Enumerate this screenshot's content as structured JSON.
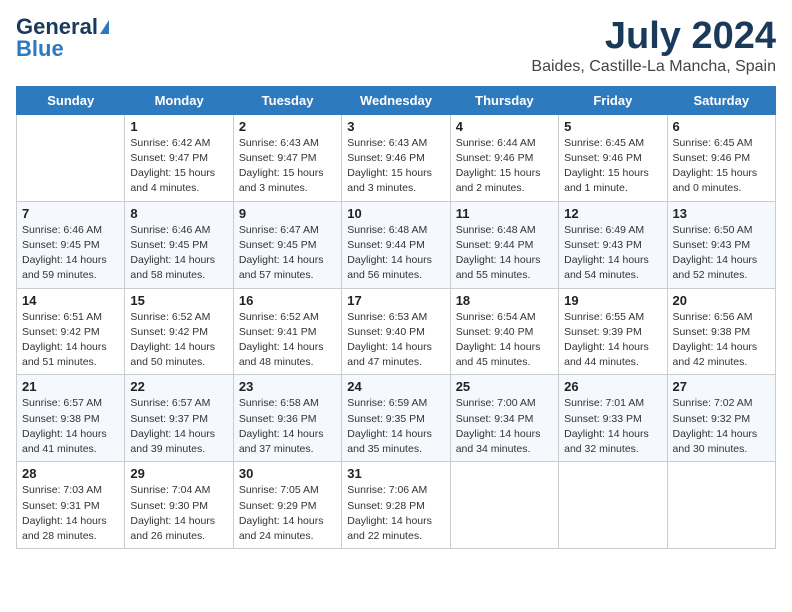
{
  "header": {
    "logo_general": "General",
    "logo_blue": "Blue",
    "month_title": "July 2024",
    "location": "Baides, Castille-La Mancha, Spain"
  },
  "days_of_week": [
    "Sunday",
    "Monday",
    "Tuesday",
    "Wednesday",
    "Thursday",
    "Friday",
    "Saturday"
  ],
  "weeks": [
    [
      {
        "day": "",
        "text": ""
      },
      {
        "day": "1",
        "text": "Sunrise: 6:42 AM\nSunset: 9:47 PM\nDaylight: 15 hours\nand 4 minutes."
      },
      {
        "day": "2",
        "text": "Sunrise: 6:43 AM\nSunset: 9:47 PM\nDaylight: 15 hours\nand 3 minutes."
      },
      {
        "day": "3",
        "text": "Sunrise: 6:43 AM\nSunset: 9:46 PM\nDaylight: 15 hours\nand 3 minutes."
      },
      {
        "day": "4",
        "text": "Sunrise: 6:44 AM\nSunset: 9:46 PM\nDaylight: 15 hours\nand 2 minutes."
      },
      {
        "day": "5",
        "text": "Sunrise: 6:45 AM\nSunset: 9:46 PM\nDaylight: 15 hours\nand 1 minute."
      },
      {
        "day": "6",
        "text": "Sunrise: 6:45 AM\nSunset: 9:46 PM\nDaylight: 15 hours\nand 0 minutes."
      }
    ],
    [
      {
        "day": "7",
        "text": "Sunrise: 6:46 AM\nSunset: 9:45 PM\nDaylight: 14 hours\nand 59 minutes."
      },
      {
        "day": "8",
        "text": "Sunrise: 6:46 AM\nSunset: 9:45 PM\nDaylight: 14 hours\nand 58 minutes."
      },
      {
        "day": "9",
        "text": "Sunrise: 6:47 AM\nSunset: 9:45 PM\nDaylight: 14 hours\nand 57 minutes."
      },
      {
        "day": "10",
        "text": "Sunrise: 6:48 AM\nSunset: 9:44 PM\nDaylight: 14 hours\nand 56 minutes."
      },
      {
        "day": "11",
        "text": "Sunrise: 6:48 AM\nSunset: 9:44 PM\nDaylight: 14 hours\nand 55 minutes."
      },
      {
        "day": "12",
        "text": "Sunrise: 6:49 AM\nSunset: 9:43 PM\nDaylight: 14 hours\nand 54 minutes."
      },
      {
        "day": "13",
        "text": "Sunrise: 6:50 AM\nSunset: 9:43 PM\nDaylight: 14 hours\nand 52 minutes."
      }
    ],
    [
      {
        "day": "14",
        "text": "Sunrise: 6:51 AM\nSunset: 9:42 PM\nDaylight: 14 hours\nand 51 minutes."
      },
      {
        "day": "15",
        "text": "Sunrise: 6:52 AM\nSunset: 9:42 PM\nDaylight: 14 hours\nand 50 minutes."
      },
      {
        "day": "16",
        "text": "Sunrise: 6:52 AM\nSunset: 9:41 PM\nDaylight: 14 hours\nand 48 minutes."
      },
      {
        "day": "17",
        "text": "Sunrise: 6:53 AM\nSunset: 9:40 PM\nDaylight: 14 hours\nand 47 minutes."
      },
      {
        "day": "18",
        "text": "Sunrise: 6:54 AM\nSunset: 9:40 PM\nDaylight: 14 hours\nand 45 minutes."
      },
      {
        "day": "19",
        "text": "Sunrise: 6:55 AM\nSunset: 9:39 PM\nDaylight: 14 hours\nand 44 minutes."
      },
      {
        "day": "20",
        "text": "Sunrise: 6:56 AM\nSunset: 9:38 PM\nDaylight: 14 hours\nand 42 minutes."
      }
    ],
    [
      {
        "day": "21",
        "text": "Sunrise: 6:57 AM\nSunset: 9:38 PM\nDaylight: 14 hours\nand 41 minutes."
      },
      {
        "day": "22",
        "text": "Sunrise: 6:57 AM\nSunset: 9:37 PM\nDaylight: 14 hours\nand 39 minutes."
      },
      {
        "day": "23",
        "text": "Sunrise: 6:58 AM\nSunset: 9:36 PM\nDaylight: 14 hours\nand 37 minutes."
      },
      {
        "day": "24",
        "text": "Sunrise: 6:59 AM\nSunset: 9:35 PM\nDaylight: 14 hours\nand 35 minutes."
      },
      {
        "day": "25",
        "text": "Sunrise: 7:00 AM\nSunset: 9:34 PM\nDaylight: 14 hours\nand 34 minutes."
      },
      {
        "day": "26",
        "text": "Sunrise: 7:01 AM\nSunset: 9:33 PM\nDaylight: 14 hours\nand 32 minutes."
      },
      {
        "day": "27",
        "text": "Sunrise: 7:02 AM\nSunset: 9:32 PM\nDaylight: 14 hours\nand 30 minutes."
      }
    ],
    [
      {
        "day": "28",
        "text": "Sunrise: 7:03 AM\nSunset: 9:31 PM\nDaylight: 14 hours\nand 28 minutes."
      },
      {
        "day": "29",
        "text": "Sunrise: 7:04 AM\nSunset: 9:30 PM\nDaylight: 14 hours\nand 26 minutes."
      },
      {
        "day": "30",
        "text": "Sunrise: 7:05 AM\nSunset: 9:29 PM\nDaylight: 14 hours\nand 24 minutes."
      },
      {
        "day": "31",
        "text": "Sunrise: 7:06 AM\nSunset: 9:28 PM\nDaylight: 14 hours\nand 22 minutes."
      },
      {
        "day": "",
        "text": ""
      },
      {
        "day": "",
        "text": ""
      },
      {
        "day": "",
        "text": ""
      }
    ]
  ]
}
